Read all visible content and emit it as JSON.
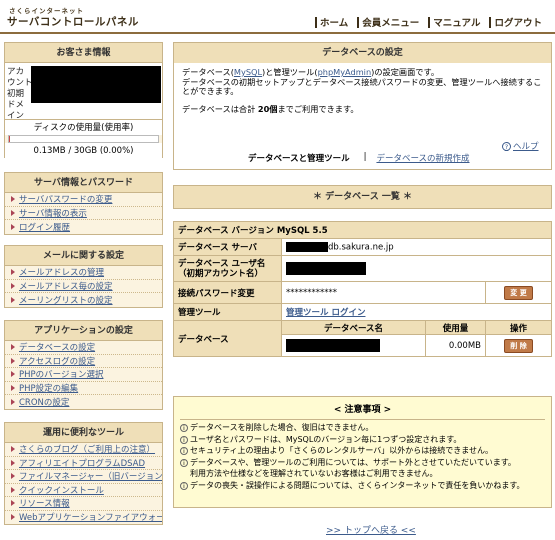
{
  "header": {
    "logo_small": "さくらインターネット",
    "logo_main": "サーバコントロールパネル",
    "nav": [
      {
        "label": "ホーム"
      },
      {
        "label": "会員メニュー"
      },
      {
        "label": "マニュアル"
      },
      {
        "label": "ログアウト"
      }
    ]
  },
  "customer": {
    "title": "お客さま情報",
    "labels": [
      "アカ",
      "ウント",
      "初期",
      "ドメ",
      "イン"
    ],
    "disk_label": "ディスクの使用量(使用率)",
    "disk_usage": "0.13MB / 30GB (0.00%)",
    "disk_percent": 0.5
  },
  "sidebar": {
    "server": {
      "title": "サーバ情報とパスワード",
      "items": [
        "サーバパスワードの変更",
        "サーバ情報の表示",
        "ログイン履歴"
      ]
    },
    "mail": {
      "title": "メールに関する設定",
      "items": [
        "メールアドレスの管理",
        "メールアドレス毎の設定",
        "メーリングリストの設定"
      ]
    },
    "app": {
      "title": "アプリケーションの設定",
      "items": [
        "データベースの設定",
        "アクセスログの設定",
        "PHPのバージョン選択",
        "PHP設定の編集",
        "CRONの設定"
      ]
    },
    "tools": {
      "title": "運用に便利なツール",
      "items": [
        "さくらのブログ（ご利用上の注意）",
        "アフィリエイトプログラムDSAD",
        "ファイルマネージャー（旧バージョン）",
        "クイックインストール",
        "リソース情報",
        "Webアプリケーションファイアウォール"
      ]
    }
  },
  "db_settings": {
    "title": "データベースの設定",
    "intro_1": "データベース(",
    "mysql_link": "MySQL",
    "intro_2": ")と管理ツール(",
    "pma_link": "phpMyAdmin",
    "intro_3": ")の設定画面です。",
    "intro_4": "データベースの初期セットアップとデータベース接続パスワードの変更、管理ツールへ接続することができます。",
    "intro_5a": "データベースは合計 ",
    "intro_5b": "20個",
    "intro_5c": "までご利用できます。",
    "help": "ヘルプ",
    "tab_active": "データベースと管理ツール",
    "tab_link": "データベースの新規作成"
  },
  "db_list": {
    "title": "＊ データベース 一覧 ＊",
    "version_label": "データベース バージョン  MySQL 5.5",
    "server_label": "データベース サーバ",
    "server_suffix": "db.sakura.ne.jp",
    "user_label": "データベース ユーザ名（初期アカウント名）",
    "pw_label": "接続パスワード変更",
    "pw_value": "************",
    "change_btn": "変 更",
    "tool_label": "管理ツール",
    "tool_link": "管理ツール ログイン",
    "db_label": "データベース",
    "col_name": "データベース名",
    "col_usage": "使用量",
    "col_op": "操作",
    "row_usage": "0.00MB",
    "delete_btn": "削 除"
  },
  "notes": {
    "title": "< 注意事項 >",
    "items": [
      "データベースを削除した場合、復旧はできません。",
      "ユーザ名とパスワードは、MySQLのバージョン毎に1つずつ設定されます。",
      "セキュリティ上の理由より「さくらのレンタルサーバ」以外からは接続できません。",
      "データベースや、管理ツールのご利用については、サポート外とさせていただいています。",
      "利用方法や仕様などを理解されていないお客様はご利用できません。",
      "データの喪失・誤操作による問題については、さくらインターネットで責任を負いかねます。"
    ]
  },
  "footer": {
    "to_top": ">> トップへ戻る <<"
  }
}
